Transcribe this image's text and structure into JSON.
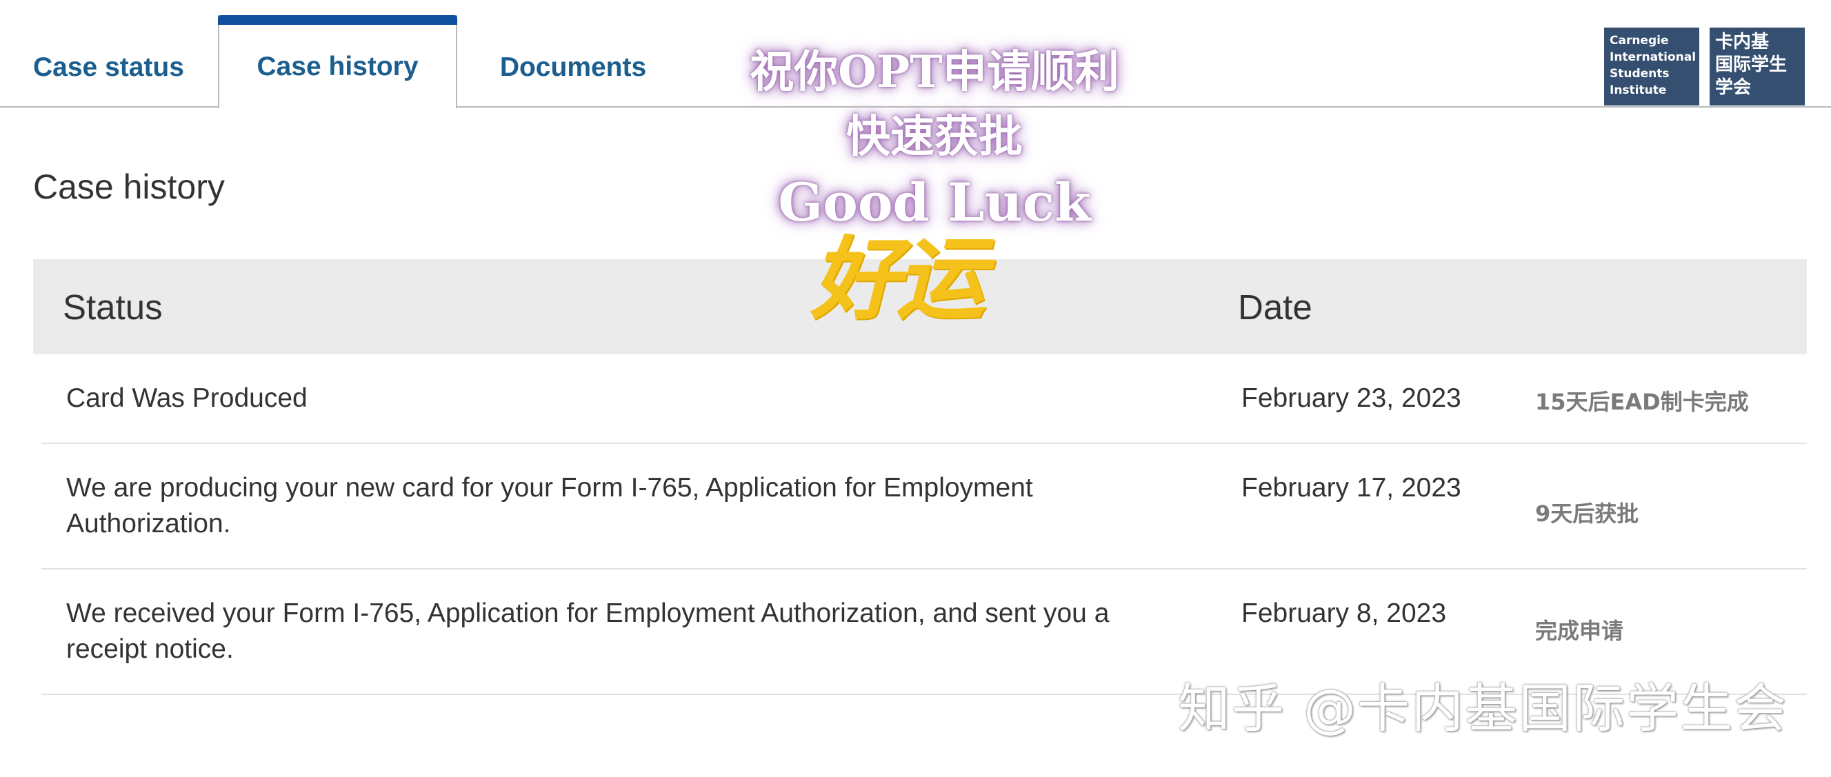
{
  "tabs": [
    {
      "label": "Case status"
    },
    {
      "label": "Case history"
    },
    {
      "label": "Documents"
    }
  ],
  "logo_en": {
    "lines": [
      "Carnegie",
      "International",
      "Students",
      "Institute"
    ]
  },
  "logo_cn": {
    "lines": [
      "卡内基",
      "国际学生",
      "学会"
    ]
  },
  "heading": "Case history",
  "table": {
    "headers": {
      "status": "Status",
      "date": "Date"
    },
    "rows": [
      {
        "status": "Card Was Produced",
        "date": "February 23, 2023",
        "note": "15天后EAD制卡完成"
      },
      {
        "status": "We are producing your new card for your Form I-765, Application for Employment Authorization.",
        "date": "February 17, 2023",
        "note": "9天后获批"
      },
      {
        "status": "We received your Form I-765, Application for Employment Authorization, and sent you a receipt notice.",
        "date": "February 8, 2023",
        "note": "完成申请"
      }
    ]
  },
  "overlay": {
    "line1": "祝你OPT申请顺利",
    "line2": "快速获批",
    "line3": "Good Luck",
    "luck": "好运"
  },
  "watermark": "知乎 @卡内基国际学生会",
  "colors": {
    "tab_text": "#1b5e8f",
    "tab_active_bar": "#0f4f9e",
    "header_bg": "#ebebeb",
    "logo_bg": "#344f70",
    "note_text": "#7a7a7a",
    "luck_text": "#f4c21a"
  }
}
